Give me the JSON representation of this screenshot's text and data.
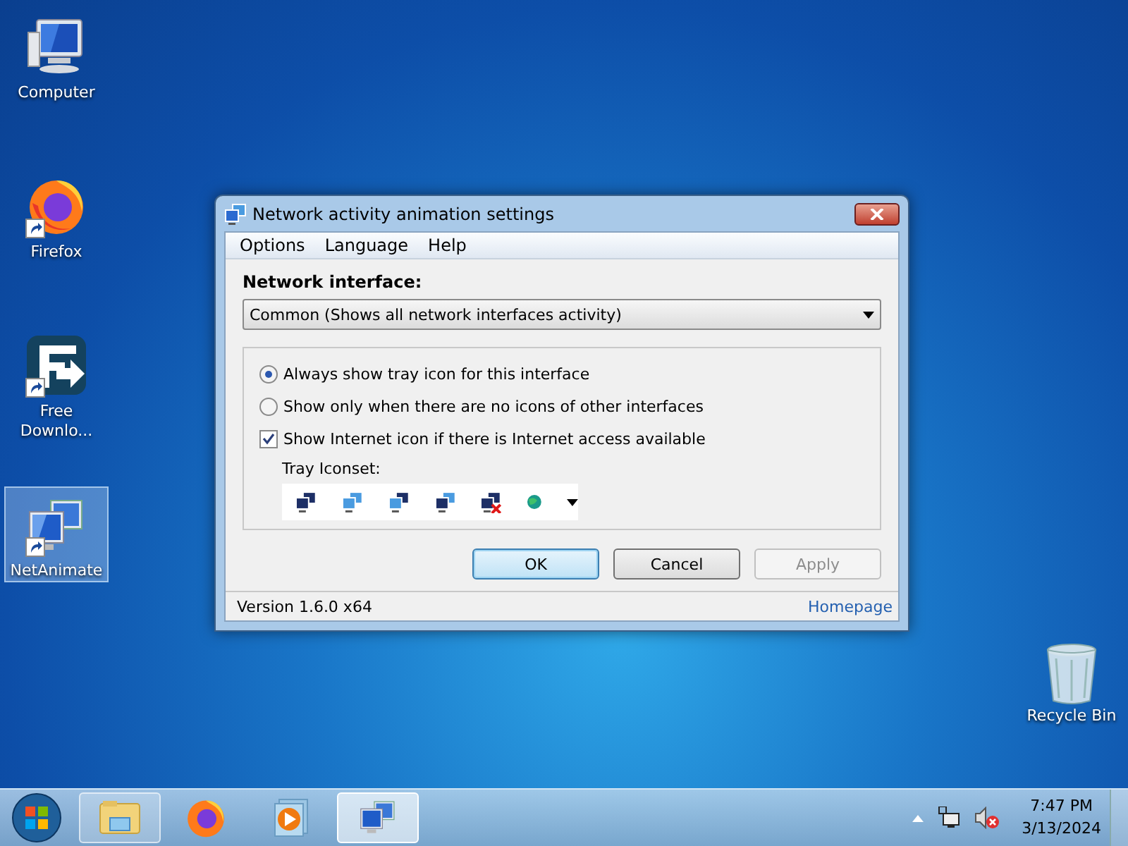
{
  "desktop_icons": [
    {
      "kind": "computer",
      "label": "Computer",
      "shortcut": false,
      "selected": false
    },
    {
      "kind": "firefox",
      "label": "Firefox",
      "shortcut": true,
      "selected": false
    },
    {
      "kind": "download",
      "label": "Free Downlo...",
      "shortcut": true,
      "selected": false
    },
    {
      "kind": "netanimate",
      "label": "NetAnimate",
      "shortcut": true,
      "selected": true
    }
  ],
  "recycle_bin": {
    "label": "Recycle Bin"
  },
  "dialog": {
    "title": "Network activity animation settings",
    "menu": [
      "Options",
      "Language",
      "Help"
    ],
    "interface_label": "Network interface:",
    "interface_value": "Common (Shows all network interfaces activity)",
    "options": [
      {
        "kind": "radio",
        "label": "Always show tray icon for this interface",
        "selected": true
      },
      {
        "kind": "radio",
        "label": "Show only when there are no icons of other interfaces",
        "selected": false
      },
      {
        "kind": "checkbox",
        "label": "Show Internet icon if there is Internet access available",
        "checked": true
      }
    ],
    "iconset_label": "Tray Iconset:",
    "iconset": [
      {
        "kind": "dark"
      },
      {
        "kind": "light"
      },
      {
        "kind": "mixed"
      },
      {
        "kind": "dark-light"
      },
      {
        "kind": "error"
      },
      {
        "kind": "globe"
      }
    ],
    "buttons": [
      {
        "label": "OK",
        "default": true,
        "disabled": false
      },
      {
        "label": "Cancel",
        "default": false,
        "disabled": false
      },
      {
        "label": "Apply",
        "default": false,
        "disabled": true
      }
    ],
    "version": "Version 1.6.0 x64",
    "homepage": "Homepage"
  },
  "taskbar": {
    "items": [
      {
        "kind": "explorer",
        "active": false,
        "open": true
      },
      {
        "kind": "firefox",
        "active": false,
        "open": false
      },
      {
        "kind": "media",
        "active": false,
        "open": false
      },
      {
        "kind": "netanimate",
        "active": true,
        "open": true
      }
    ],
    "time": "7:47 PM",
    "date": "3/13/2024"
  }
}
